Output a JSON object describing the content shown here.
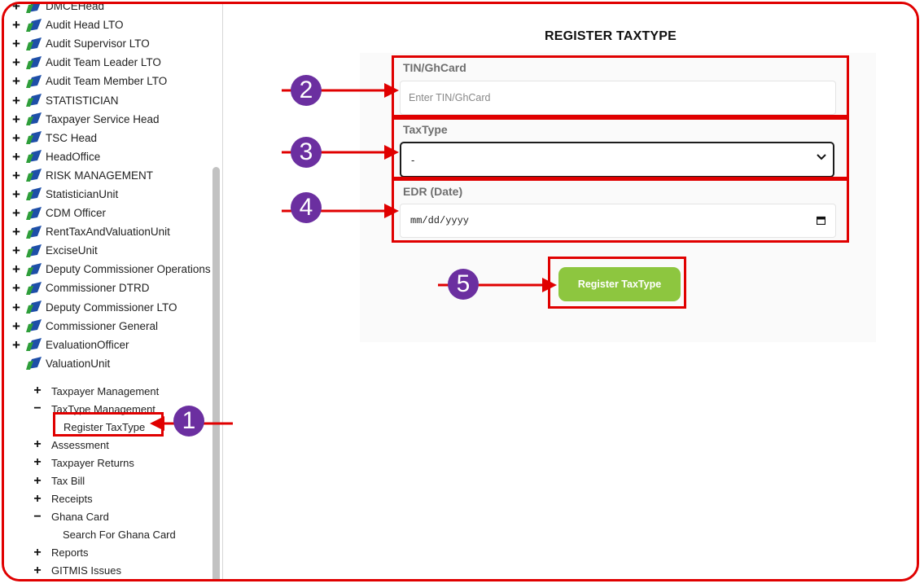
{
  "sidebar": {
    "roles": [
      {
        "label": "DMCEHead",
        "expandable": true
      },
      {
        "label": "Audit Head LTO",
        "expandable": true
      },
      {
        "label": "Audit Supervisor LTO",
        "expandable": true
      },
      {
        "label": "Audit Team Leader LTO",
        "expandable": true
      },
      {
        "label": "Audit Team Member LTO",
        "expandable": true
      },
      {
        "label": "STATISTICIAN",
        "expandable": true
      },
      {
        "label": "Taxpayer Service Head",
        "expandable": true
      },
      {
        "label": "TSC Head",
        "expandable": true
      },
      {
        "label": "HeadOffice",
        "expandable": true
      },
      {
        "label": "RISK MANAGEMENT",
        "expandable": true
      },
      {
        "label": "StatisticianUnit",
        "expandable": true
      },
      {
        "label": "CDM Officer",
        "expandable": true
      },
      {
        "label": "RentTaxAndValuationUnit",
        "expandable": true
      },
      {
        "label": "ExciseUnit",
        "expandable": true
      },
      {
        "label": "Deputy Commissioner Operations",
        "expandable": true
      },
      {
        "label": "Commissioner DTRD",
        "expandable": true
      },
      {
        "label": "Deputy Commissioner LTO",
        "expandable": true
      },
      {
        "label": "Commissioner General",
        "expandable": true
      },
      {
        "label": "EvaluationOfficer",
        "expandable": true
      },
      {
        "label": "ValuationUnit",
        "expandable": false
      }
    ],
    "menu": [
      {
        "sign": "+",
        "label": "Taxpayer Management"
      },
      {
        "sign": "−",
        "label": "TaxType Management"
      },
      {
        "sign": "",
        "label": "Register TaxType",
        "sub": true,
        "selected": true
      },
      {
        "sign": "+",
        "label": "Assessment"
      },
      {
        "sign": "+",
        "label": "Taxpayer Returns"
      },
      {
        "sign": "+",
        "label": "Tax Bill"
      },
      {
        "sign": "+",
        "label": "Receipts"
      },
      {
        "sign": "−",
        "label": "Ghana Card"
      },
      {
        "sign": "",
        "label": "Search For Ghana Card",
        "sub": true
      },
      {
        "sign": "+",
        "label": "Reports"
      },
      {
        "sign": "+",
        "label": "GITMIS Issues"
      }
    ]
  },
  "form": {
    "title": "REGISTER TAXTYPE",
    "tin_label": "TIN/GhCard",
    "tin_placeholder": "Enter TIN/GhCard",
    "taxtype_label": "TaxType",
    "taxtype_value": "-",
    "edr_label": "EDR (Date)",
    "edr_placeholder": "mm/dd/yyyy",
    "submit_label": "Register TaxType"
  },
  "annotations": {
    "step1": "1",
    "step2": "2",
    "step3": "3",
    "step4": "4",
    "step5": "5"
  },
  "colors": {
    "highlight": "#e00000",
    "badge": "#6b2fa0",
    "button": "#8dc63f",
    "folder_blue": "#1e4fa8",
    "folder_green": "#2e9e3a"
  }
}
